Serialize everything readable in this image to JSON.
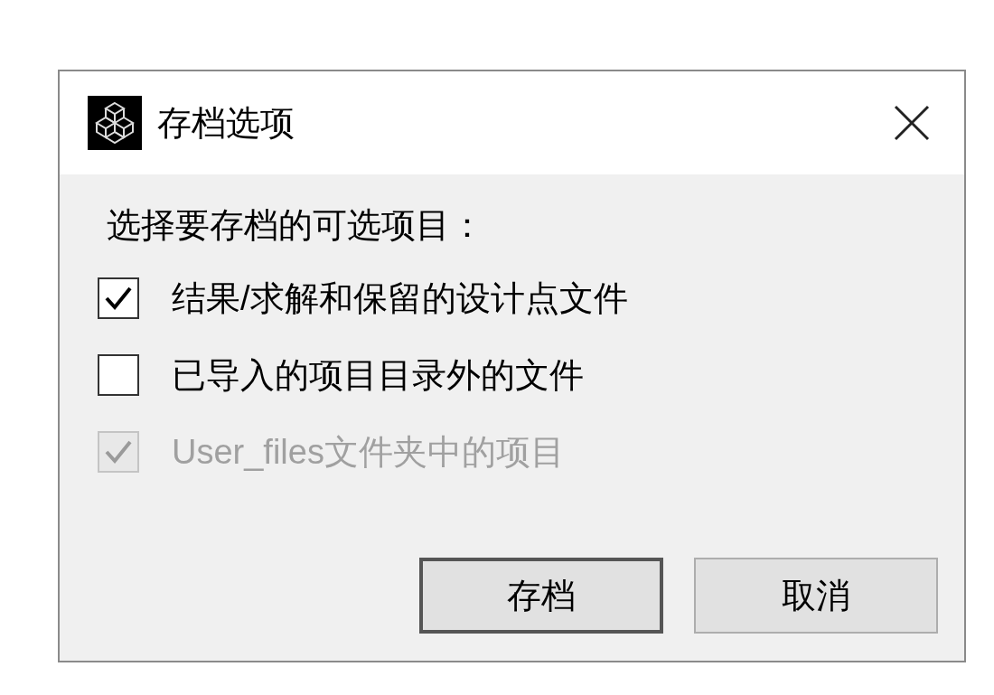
{
  "window": {
    "title": "存档选项"
  },
  "prompt": "选择要存档的可选项目：",
  "options": [
    {
      "label": "结果/求解和保留的设计点文件",
      "checked": true,
      "disabled": false
    },
    {
      "label": "已导入的项目目录外的文件",
      "checked": false,
      "disabled": false
    },
    {
      "label": "User_files文件夹中的项目",
      "checked": true,
      "disabled": true
    }
  ],
  "buttons": [
    {
      "label": "存档",
      "default": true
    },
    {
      "label": "取消",
      "default": false
    }
  ]
}
